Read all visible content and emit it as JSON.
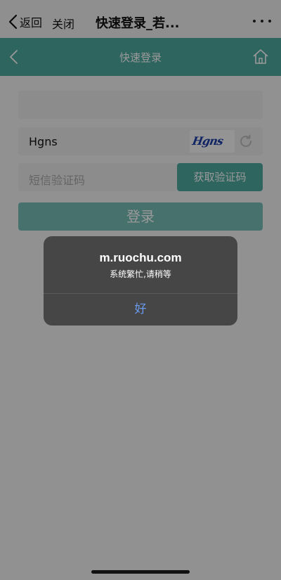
{
  "topbar": {
    "back_label": "返回",
    "close_label": "关闭",
    "title": "快速登录_若..."
  },
  "header": {
    "title": "快速登录",
    "color": "#4ea89f"
  },
  "form": {
    "phone_value": "",
    "captcha_value": "Hgns",
    "captcha_image_text": "Hgns",
    "sms_placeholder": "短信验证码",
    "sms_button_label": "获取验证码",
    "login_button_label": "登录"
  },
  "alert": {
    "title": "m.ruochu.com",
    "message": "系统繁忙,请稍等",
    "ok_label": "好"
  }
}
